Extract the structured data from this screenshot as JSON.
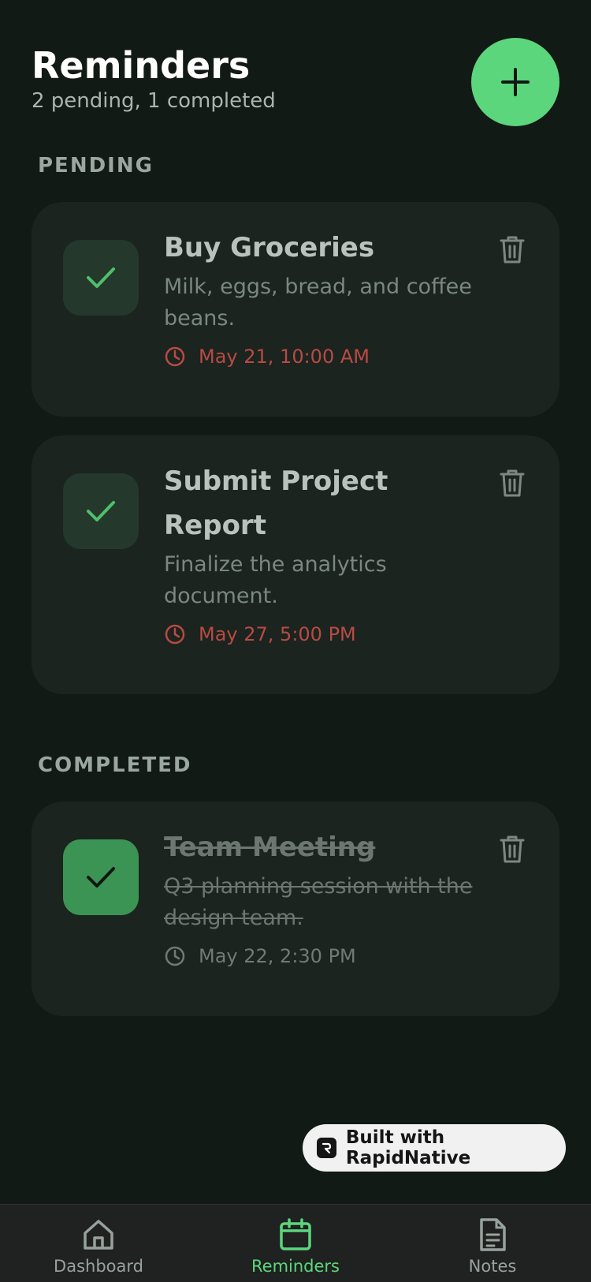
{
  "header": {
    "title": "Reminders",
    "subtitle": "2 pending, 1 completed"
  },
  "sections": {
    "pending": "PENDING",
    "completed": "COMPLETED"
  },
  "reminders": [
    {
      "title": "Buy Groceries",
      "description": "Milk, eggs, bread, and coffee beans.",
      "time": "May 21, 10:00 AM",
      "completed": false
    },
    {
      "title": "Submit Project Report",
      "description": "Finalize the analytics document.",
      "time": "May 27, 5:00 PM",
      "completed": false
    },
    {
      "title": "Team Meeting",
      "description": "Q3 planning session with the design team.",
      "time": "May 22, 2:30 PM",
      "completed": true
    }
  ],
  "badge": {
    "label": "Built with RapidNative"
  },
  "nav": {
    "items": [
      {
        "label": "Dashboard",
        "icon": "home-icon"
      },
      {
        "label": "Reminders",
        "icon": "calendar-icon",
        "active": true
      },
      {
        "label": "Notes",
        "icon": "document-icon"
      }
    ]
  },
  "colors": {
    "accent": "#5cd67c",
    "background": "#121a16",
    "card": "#1b241f",
    "overdue": "#b94a44"
  }
}
